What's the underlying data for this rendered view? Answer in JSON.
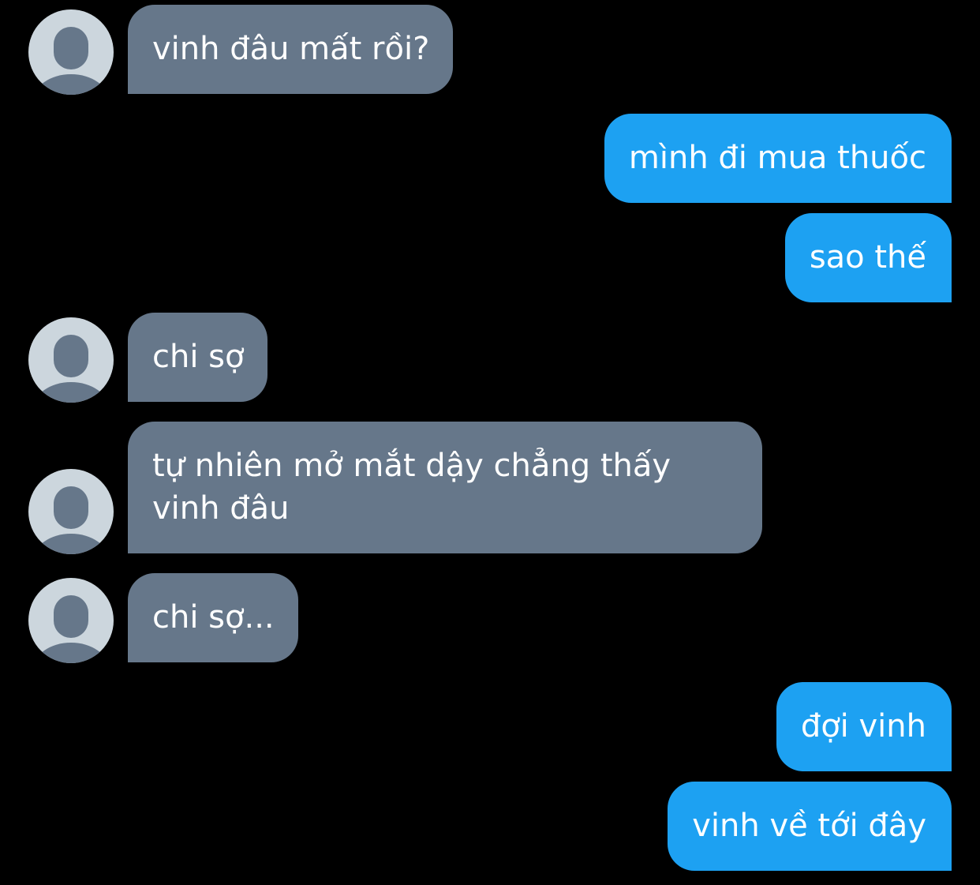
{
  "colors": {
    "background": "#000000",
    "incoming_bubble": "#66778a",
    "outgoing_bubble": "#1da1f2",
    "avatar_background": "#ccd6dd",
    "avatar_figure": "#66778a",
    "text": "#ffffff"
  },
  "avatar_icon": "default-profile-icon",
  "messages": [
    {
      "direction": "incoming",
      "text": "vinh đâu mất rồi?"
    },
    {
      "direction": "outgoing",
      "text": "mình đi mua thuốc"
    },
    {
      "direction": "outgoing",
      "text": "sao thế"
    },
    {
      "direction": "incoming",
      "text": "chi sợ"
    },
    {
      "direction": "incoming",
      "lines": [
        "tự nhiên mở mắt dậy chẳng thấy",
        "vinh đâu"
      ]
    },
    {
      "direction": "incoming",
      "text": "chi sợ..."
    },
    {
      "direction": "outgoing",
      "text": "đợi vinh"
    },
    {
      "direction": "outgoing",
      "text": "vinh về tới đây"
    }
  ]
}
